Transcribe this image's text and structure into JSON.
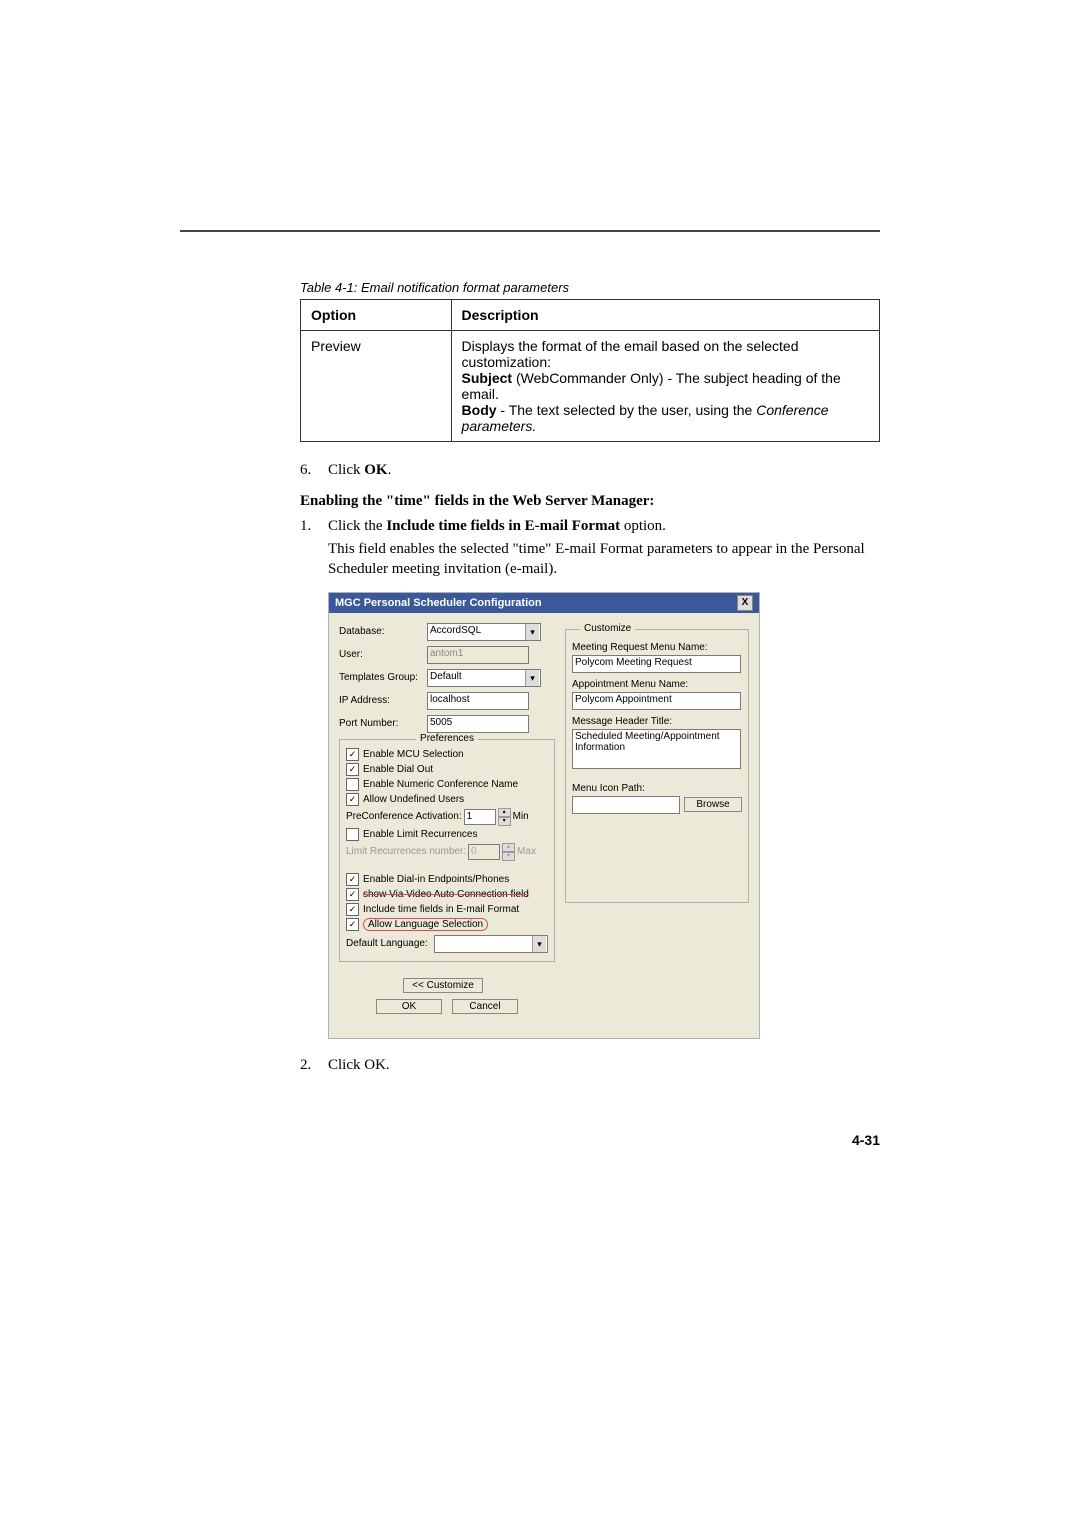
{
  "table": {
    "caption": "Table 4-1: Email notification format parameters",
    "header_option": "Option",
    "header_description": "Description",
    "row_option": "Preview",
    "desc_line1": "Displays the format of the email based on the selected customization:",
    "desc_subject_bold": "Subject",
    "desc_subject_rest": " (WebCommander Only) - The subject heading of the email.",
    "desc_body_bold": "Body",
    "desc_body_rest": " - The text selected by the user, using the ",
    "desc_body_italic": "Conference parameters."
  },
  "step6_num": "6.",
  "step6_text_a": "Click ",
  "step6_ok": "OK",
  "step6_text_b": ".",
  "subheading": "Enabling the \"time\" fields in the Web Server Manager:",
  "step1_num": "1.",
  "step1_a": "Click the ",
  "step1_bold": "Include time fields in E-mail Format",
  "step1_b": " option.",
  "step1_body": "This field enables the selected \"time\" E-mail Format parameters to appear in the Personal Scheduler meeting invitation (e-mail).",
  "dialog": {
    "title": "MGC Personal Scheduler Configuration",
    "close_x": "X",
    "labels": {
      "database": "Database:",
      "user": "User:",
      "templates_group": "Templates Group:",
      "ip_address": "IP Address:",
      "port_number": "Port Number:"
    },
    "values": {
      "database": "AccordSQL",
      "user": "antom1",
      "templates_group": "Default",
      "ip_address": "localhost",
      "port_number": "5005"
    },
    "prefs_legend": "Preferences",
    "checks": {
      "enable_mcu": "Enable MCU Selection",
      "enable_dialout": "Enable Dial Out",
      "enable_numeric": "Enable Numeric Conference Name",
      "allow_undefined": "Allow Undefined Users",
      "preconf_label": "PreConference Activation:",
      "preconf_value": "1",
      "preconf_min": "Min",
      "enable_limit": "Enable Limit Recurrences",
      "limit_label": "Limit Recurrences number:",
      "limit_value": "0",
      "limit_max": "Max",
      "enable_dialin": "Enable Dial-in Endpoints/Phones",
      "show_via_video": "show Via Video Auto Connection field",
      "include_time": "Include time fields in E-mail Format",
      "allow_lang": "Allow Language Selection",
      "default_lang": "Default Language:"
    },
    "customize": {
      "legend": "Customize",
      "mrm_label": "Meeting Request Menu Name:",
      "mrm_value": "Polycom Meeting Request",
      "amn_label": "Appointment Menu Name:",
      "amn_value": "Polycom Appointment",
      "mht_label": "Message Header Title:",
      "mht_value": "Scheduled Meeting/Appointment Information",
      "mip_label": "Menu Icon Path:",
      "browse": "Browse"
    },
    "buttons": {
      "customize_btn": "<< Customize",
      "ok": "OK",
      "cancel": "Cancel"
    }
  },
  "step2_num": "2.",
  "step2_text": "Click OK.",
  "page_number": "4-31"
}
